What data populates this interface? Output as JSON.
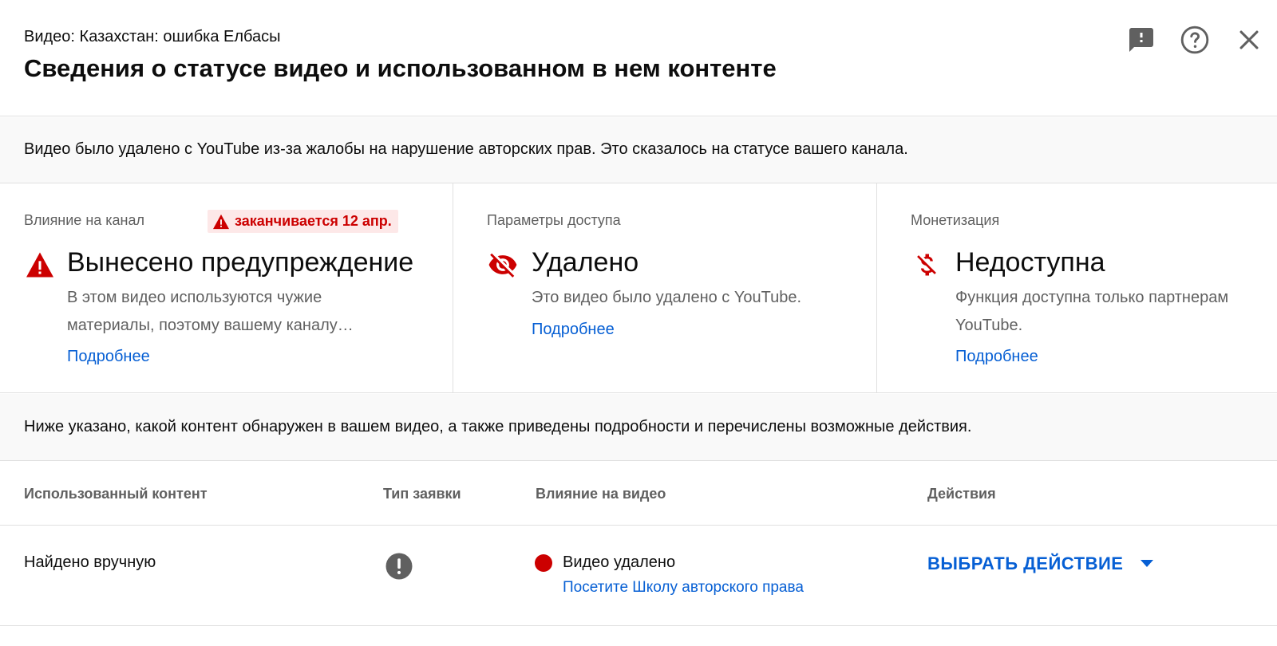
{
  "header": {
    "video_line": "Видео: Казахстан: ошибка Елбасы",
    "title": "Сведения о статусе видео и использованном в нем контенте",
    "icons": [
      "feedback-icon",
      "help-icon",
      "close-icon"
    ]
  },
  "banner": {
    "text": "Видео было удалено с YouTube из-за жалобы на нарушение авторских прав. Это сказалось на статусе вашего канала."
  },
  "cards": {
    "channel": {
      "label": "Влияние на канал",
      "badge": "заканчивается 12 апр.",
      "icon": "warning-icon",
      "title": "Вынесено предупреждение",
      "desc_line1": "В этом видео используются чужие",
      "desc_line2": "материалы, поэтому вашему каналу…",
      "link": "Подробнее"
    },
    "visibility": {
      "label": "Параметры доступа",
      "icon": "visibility-off-icon",
      "title": "Удалено",
      "desc_line1": "Это видео было удалено с YouTube.",
      "link": "Подробнее"
    },
    "monetization": {
      "label": "Монетизация",
      "icon": "money-off-icon",
      "title": "Недоступна",
      "desc_line1": "Функция доступна только партнерам",
      "desc_line2": "YouTube.",
      "link": "Подробнее"
    }
  },
  "content_banner": {
    "text": "Ниже указано, какой контент обнаружен в вашем видео, а также приведены подробности и перечислены возможные действия."
  },
  "table": {
    "headers": {
      "content": "Использованный контент",
      "claim_type": "Тип заявки",
      "impact": "Влияние на видео",
      "actions": "Действия"
    },
    "rows": [
      {
        "content": "Найдено вручную",
        "claim_type_icon": "copyright-strike-icon",
        "impact": "Видео удалено",
        "impact_link": "Посетите Школу авторского права",
        "action": "ВЫБРАТЬ ДЕЙСТВИЕ"
      }
    ]
  },
  "colors": {
    "accent_blue": "#065fd4",
    "alert_red": "#cc0000",
    "muted_text": "#606060",
    "banner_bg": "#f9f9f9"
  }
}
